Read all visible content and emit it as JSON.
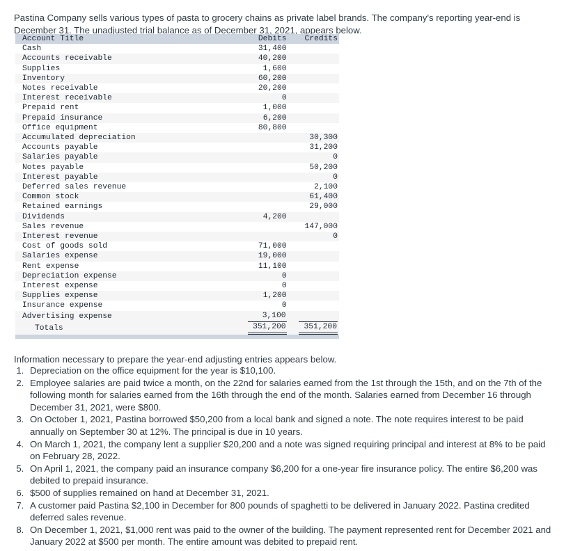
{
  "intro": {
    "paragraph": "Pastina Company sells various types of pasta to grocery chains as private label brands. The company's reporting year-end is December 31. The unadjusted trial balance as of December 31, 2021, appears below."
  },
  "trial_balance": {
    "headers": {
      "account_title": "Account Title",
      "debits": "Debits",
      "credits": "Credits"
    },
    "rows": [
      {
        "title": "Cash",
        "debit": "31,400",
        "credit": ""
      },
      {
        "title": "Accounts receivable",
        "debit": "40,200",
        "credit": ""
      },
      {
        "title": "Supplies",
        "debit": "1,600",
        "credit": ""
      },
      {
        "title": "Inventory",
        "debit": "60,200",
        "credit": ""
      },
      {
        "title": "Notes receivable",
        "debit": "20,200",
        "credit": ""
      },
      {
        "title": "Interest receivable",
        "debit": "0",
        "credit": ""
      },
      {
        "title": "Prepaid rent",
        "debit": "1,000",
        "credit": ""
      },
      {
        "title": "Prepaid insurance",
        "debit": "6,200",
        "credit": ""
      },
      {
        "title": "Office equipment",
        "debit": "80,800",
        "credit": ""
      },
      {
        "title": "Accumulated depreciation",
        "debit": "",
        "credit": "30,300"
      },
      {
        "title": "Accounts payable",
        "debit": "",
        "credit": "31,200"
      },
      {
        "title": "Salaries payable",
        "debit": "",
        "credit": "0"
      },
      {
        "title": "Notes payable",
        "debit": "",
        "credit": "50,200"
      },
      {
        "title": "Interest payable",
        "debit": "",
        "credit": "0"
      },
      {
        "title": "Deferred sales revenue",
        "debit": "",
        "credit": "2,100"
      },
      {
        "title": "Common stock",
        "debit": "",
        "credit": "61,400"
      },
      {
        "title": "Retained earnings",
        "debit": "",
        "credit": "29,000"
      },
      {
        "title": "Dividends",
        "debit": "4,200",
        "credit": ""
      },
      {
        "title": "Sales revenue",
        "debit": "",
        "credit": "147,000"
      },
      {
        "title": "Interest revenue",
        "debit": "",
        "credit": "0"
      },
      {
        "title": "Cost of goods sold",
        "debit": "71,000",
        "credit": ""
      },
      {
        "title": "Salaries expense",
        "debit": "19,000",
        "credit": ""
      },
      {
        "title": "Rent expense",
        "debit": "11,100",
        "credit": ""
      },
      {
        "title": "Depreciation expense",
        "debit": "0",
        "credit": ""
      },
      {
        "title": "Interest expense",
        "debit": "0",
        "credit": ""
      },
      {
        "title": "Supplies expense",
        "debit": "1,200",
        "credit": ""
      },
      {
        "title": "Insurance expense",
        "debit": "0",
        "credit": ""
      },
      {
        "title": "Advertising expense",
        "debit": "3,100",
        "credit": ""
      }
    ],
    "totals": {
      "label": "Totals",
      "debit": "351,200",
      "credit": "351,200"
    }
  },
  "info_line": "Information necessary to prepare the year-end adjusting entries appears below.",
  "adjustments": [
    "Depreciation on the office equipment for the year is $10,100.",
    "Employee salaries are paid twice a month, on the 22nd for salaries earned from the 1st through the 15th, and on the 7th of the following month for salaries earned from the 16th through the end of the month. Salaries earned from December 16 through December 31, 2021, were $800.",
    "On October 1, 2021, Pastina borrowed $50,200 from a local bank and signed a note. The note requires interest to be paid annually on September 30 at 12%. The principal is due in 10 years.",
    "On March 1, 2021, the company lent a supplier $20,200 and a note was signed requiring principal and interest at 8% to be paid on February 28, 2022.",
    "On April 1, 2021, the company paid an insurance company $6,200 for a one-year fire insurance policy. The entire $6,200 was debited to prepaid insurance.",
    "$500 of supplies remained on hand at December 31, 2021.",
    "A customer paid Pastina $2,100 in December for 800 pounds of spaghetti to be delivered in January 2022. Pastina credited deferred sales revenue.",
    "On December 1, 2021, $1,000 rent was paid to the owner of the building. The payment represented rent for December 2021 and January 2022 at $500 per month. The entire amount was debited to prepaid rent."
  ],
  "colors": {
    "text": "#2d3b45",
    "table_header_bg": "#ccd5e0",
    "table_stripe": "#f5f5f5"
  }
}
